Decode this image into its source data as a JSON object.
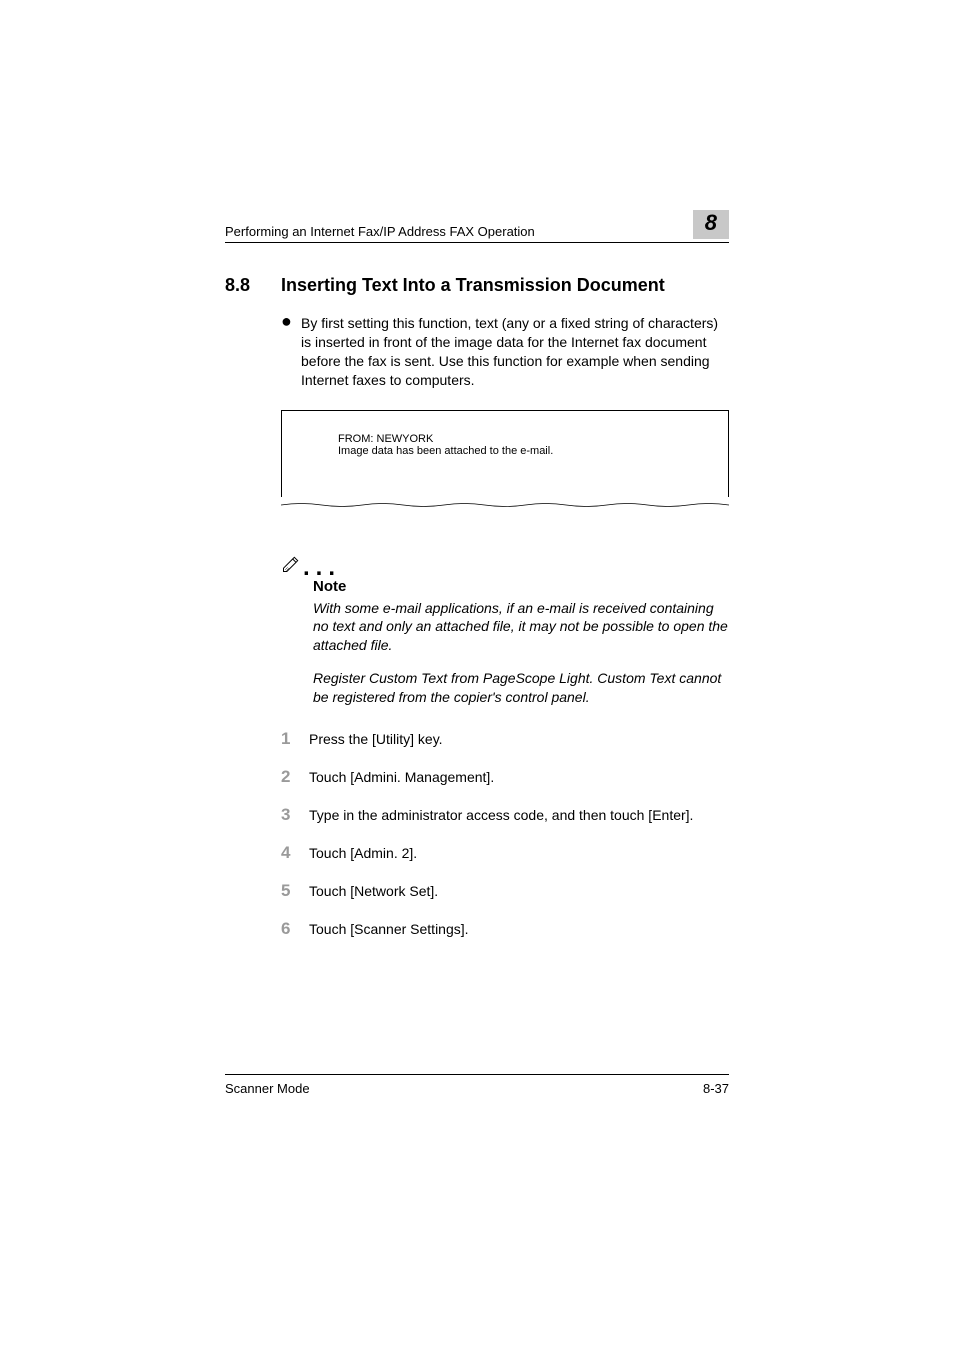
{
  "header": {
    "title": "Performing an Internet Fax/IP Address FAX Operation",
    "chapter": "8"
  },
  "section": {
    "number": "8.8",
    "title": "Inserting Text Into a Transmission Document"
  },
  "bullet": {
    "text": "By first setting this function, text (any or a fixed string of characters) is inserted in front of the image data for the Internet fax document before the fax is sent. Use this function for example when sending Internet faxes to computers."
  },
  "diagram": {
    "line1": "FROM: NEWYORK",
    "line2": "Image data has been attached to the e-mail."
  },
  "note": {
    "heading": "Note",
    "para1": "With some e-mail applications, if an e-mail is received containing no text and only an attached file, it may not be possible to open the attached file.",
    "para2": "Register Custom Text from PageScope Light. Custom Text cannot be registered from the copier's control panel."
  },
  "steps": [
    {
      "num": "1",
      "text": "Press the [Utility] key."
    },
    {
      "num": "2",
      "text": "Touch [Admini. Management]."
    },
    {
      "num": "3",
      "text": "Type in the administrator access code, and then touch [Enter]."
    },
    {
      "num": "4",
      "text": "Touch [Admin. 2]."
    },
    {
      "num": "5",
      "text": "Touch [Network Set]."
    },
    {
      "num": "6",
      "text": "Touch [Scanner Settings]."
    }
  ],
  "footer": {
    "left": "Scanner Mode",
    "right": "8-37"
  }
}
